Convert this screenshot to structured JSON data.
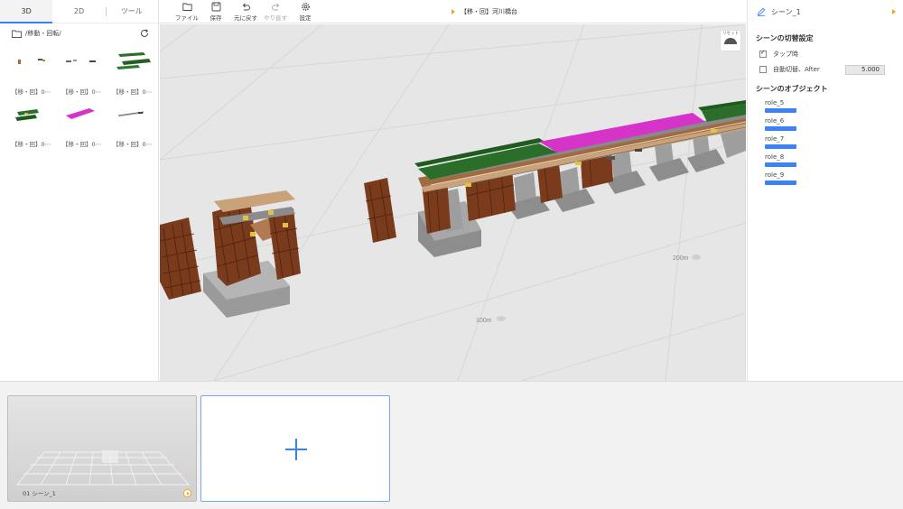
{
  "left_panel": {
    "tabs": [
      {
        "label": "3D",
        "active": true
      },
      {
        "label": "2D",
        "active": false
      },
      {
        "label": "ツール",
        "active": false
      }
    ],
    "path": "/移動・回転/",
    "assets": [
      {
        "label": "【移・回】0⋯",
        "icon": "small-parts-thumbnail"
      },
      {
        "label": "【移・回】0⋯",
        "icon": "beam-pieces-thumbnail"
      },
      {
        "label": "【移・回】0⋯",
        "icon": "green-girders-thumbnail"
      },
      {
        "label": "【移・回】0⋯",
        "icon": "green-deck-thumbnail"
      },
      {
        "label": "【移・回】0⋯",
        "icon": "pink-slab-thumbnail"
      },
      {
        "label": "【移・回】0⋯",
        "icon": "rail-thumbnail"
      }
    ]
  },
  "toolbar": {
    "file": "ファイル",
    "save": "保存",
    "undo": "元に戻す",
    "redo": "やり直す",
    "settings": "設定",
    "title": "【移・回】河川橋台"
  },
  "viewport": {
    "reset_label": "リセット",
    "markers": [
      "100m",
      "200m"
    ],
    "colors": {
      "background": "#e6e6e6",
      "pier": "#8d8d8d",
      "scaffold": "#7a3b1c",
      "girder": "#2a6e2a",
      "slab": "#d633c8"
    }
  },
  "right_panel": {
    "scene_name": "シーン_1",
    "switch_section": "シーンの切替設定",
    "on_tap_label": "タップ時",
    "on_tap_checked": true,
    "auto_switch_label": "自動切替、After",
    "auto_switch_checked": false,
    "after_value": "5.000",
    "objects_section": "シーンのオブジェクト",
    "objects": [
      "role_5",
      "role_6",
      "role_7",
      "role_8",
      "role_9"
    ]
  },
  "bottom": {
    "scene_card_label": "01 シーン_1"
  },
  "accent_color": "#3b82f6"
}
